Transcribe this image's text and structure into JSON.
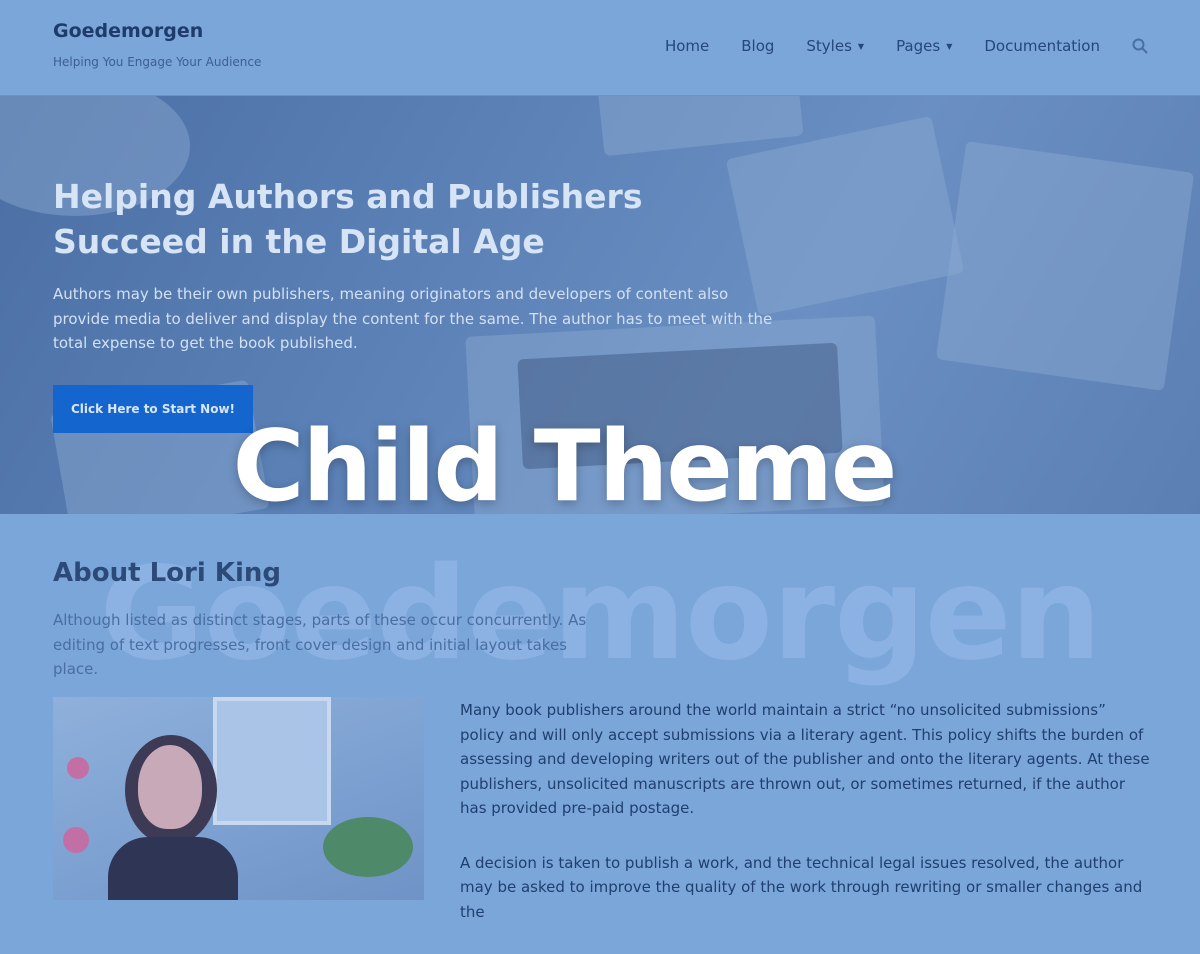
{
  "site": {
    "title": "Goedemorgen",
    "tagline": "Helping You Engage Your Audience"
  },
  "nav": {
    "items": [
      {
        "label": "Home",
        "has_dropdown": false
      },
      {
        "label": "Blog",
        "has_dropdown": false
      },
      {
        "label": "Styles",
        "has_dropdown": true
      },
      {
        "label": "Pages",
        "has_dropdown": true
      },
      {
        "label": "Documentation",
        "has_dropdown": false
      }
    ],
    "search_icon": "search-icon"
  },
  "hero": {
    "title_line1": "Helping Authors and Publishers",
    "title_line2": "Succeed in the Digital Age",
    "text": "Authors may be their own publishers, meaning originators and developers of content also provide media to deliver and display the content for the same. The author has to meet with the total expense to get the book published.",
    "button_label": "Click Here to Start Now!"
  },
  "overlay": {
    "title": "Child Theme",
    "watermark": "Goedemorgen"
  },
  "about": {
    "title": "About Lori King",
    "intro": "Although listed as distinct stages, parts of these occur concurrently. As editing of text progresses, front cover design and initial layout takes place.",
    "paragraphs": [
      "Many book publishers around the world maintain a strict “no unsolicited submissions” policy and will only accept submissions via a literary agent. This policy shifts the burden of assessing and developing writers out of the publisher and onto the literary agents. At these publishers, unsolicited manuscripts are thrown out, or sometimes returned, if the author has provided pre-paid postage.",
      "A decision is taken to publish a work, and the technical legal issues resolved, the author may be asked to improve the quality of the work through rewriting or smaller changes and the"
    ]
  },
  "colors": {
    "background": "#7ba6da",
    "button": "#1565cf",
    "heading": "#2b4a78"
  }
}
